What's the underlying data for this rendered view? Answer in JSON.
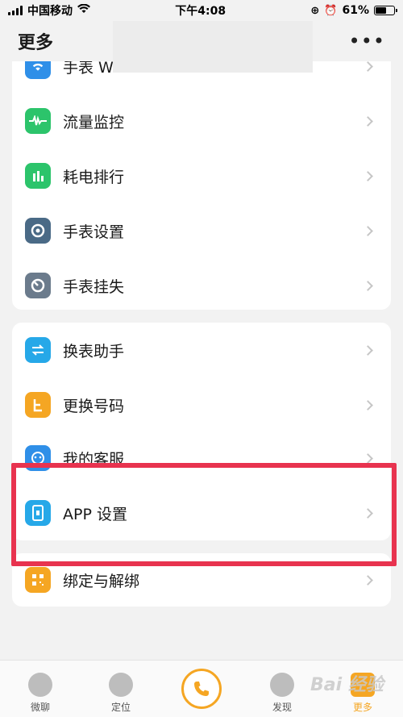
{
  "status_bar": {
    "carrier": "中国移动",
    "time": "下午4:08",
    "battery": "61%",
    "battery_level": 0.61
  },
  "header": {
    "title": "更多",
    "more_label": "•••"
  },
  "card1": {
    "items": [
      {
        "label": "手表 W",
        "icon": "wifi-icon"
      },
      {
        "label": "流量监控",
        "icon": "waveform-icon"
      },
      {
        "label": "耗电排行",
        "icon": "bar-chart-icon"
      },
      {
        "label": "手表设置",
        "icon": "watch-settings-icon"
      },
      {
        "label": "手表挂失",
        "icon": "watch-lost-icon"
      }
    ]
  },
  "card2": {
    "items": [
      {
        "label": "换表助手",
        "icon": "swap-icon"
      },
      {
        "label": "更换号码",
        "icon": "change-number-icon"
      },
      {
        "label": "我的客服",
        "icon": "customer-service-icon"
      },
      {
        "label": "APP 设置",
        "icon": "app-settings-icon"
      }
    ]
  },
  "card3": {
    "items": [
      {
        "label": "绑定与解绑",
        "icon": "qr-code-icon"
      }
    ]
  },
  "bottom_nav": {
    "items": [
      {
        "label": "微聊",
        "icon": "chat-icon"
      },
      {
        "label": "定位",
        "icon": "location-icon"
      },
      {
        "label": "",
        "icon": "phone-icon"
      },
      {
        "label": "发现",
        "icon": "discover-icon"
      },
      {
        "label": "更多",
        "icon": "more-icon",
        "active": true
      }
    ]
  },
  "watermark": "Bai 经验",
  "colors": {
    "accent": "#f5a623",
    "highlight": "#e8334f",
    "wifi": "#2f8fe8",
    "green": "#2cc46b",
    "slate": "#4a6a86",
    "cyan": "#26a8e8",
    "orange": "#f5a623"
  }
}
